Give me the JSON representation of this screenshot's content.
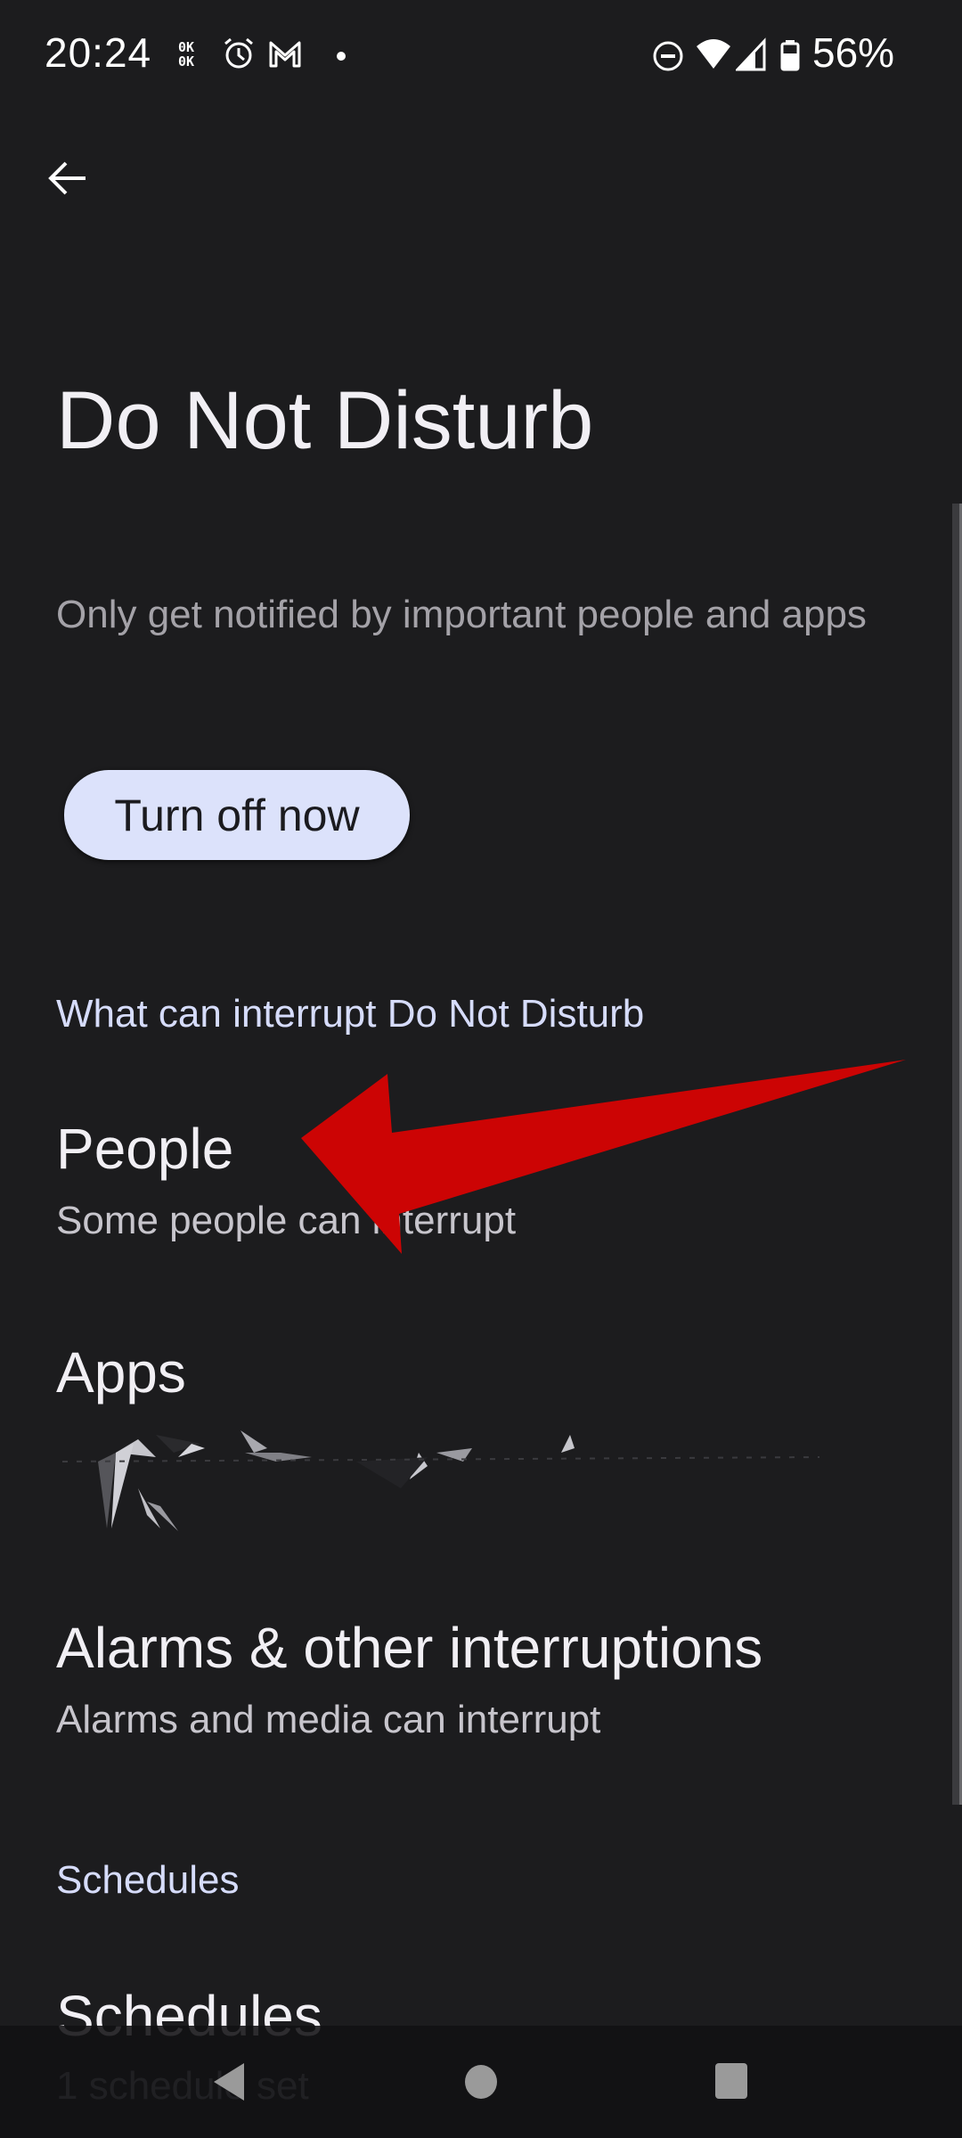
{
  "status_bar": {
    "time": "20:24",
    "net_speed_up": "0K",
    "net_speed_down": "0K",
    "icons": [
      "data-speed-icon",
      "alarm-icon",
      "gmail-icon",
      "notification-dot-icon",
      "do-not-disturb-icon",
      "wifi-icon",
      "cellular-signal-icon",
      "battery-icon"
    ],
    "battery_percent": "56%"
  },
  "header": {
    "back_icon": "arrow-back-icon",
    "title": "Do Not Disturb"
  },
  "intro": {
    "description": "Only get notified by important people and apps",
    "turn_off_button": "Turn off now"
  },
  "sections": [
    {
      "header": "What can interrupt Do Not Disturb",
      "items": [
        {
          "title": "People",
          "summary": "Some people can interrupt"
        },
        {
          "title": "Apps",
          "summary": "[redacted]"
        },
        {
          "title": "Alarms & other interruptions",
          "summary": "Alarms and media can interrupt"
        }
      ]
    },
    {
      "header": "Schedules",
      "items": [
        {
          "title": "Schedules",
          "summary": "1 schedule set"
        }
      ]
    }
  ],
  "annotation": {
    "type": "arrow",
    "points_to": "People",
    "color": "#cc0404"
  },
  "colors": {
    "background": "#1c1c1e",
    "accent_header": "#d6dcfb",
    "button_bg": "#dce2fb",
    "annotation_red": "#cc0404"
  },
  "nav_bar": {
    "back": "nav-back-icon",
    "home": "nav-home-icon",
    "recents": "nav-recents-icon"
  }
}
